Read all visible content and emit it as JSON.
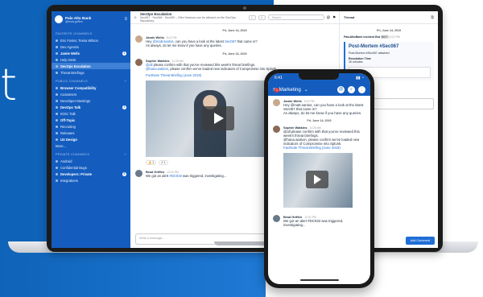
{
  "hero": {
    "letter": "t"
  },
  "sidebar": {
    "team": "Palo Alto Bank",
    "user": "@brad.griffen",
    "favorite_header": "FAVORITE CHANNELS",
    "favorites": [
      {
        "label": "Eric Foster, Tessa Wilson",
        "bold": false
      },
      {
        "label": "Dev Agenda",
        "bold": false
      },
      {
        "label": "Jamie Wells",
        "bold": true,
        "badge": "1"
      },
      {
        "label": "Help Desk",
        "bold": false
      },
      {
        "label": "SecOps Escalation",
        "bold": true,
        "active": true
      },
      {
        "label": "Threat Briefings",
        "bold": false
      }
    ],
    "public_header": "PUBLIC CHANNELS",
    "public": [
      {
        "label": "Browser Compatibility",
        "bold": true
      },
      {
        "label": "Customers",
        "bold": false
      },
      {
        "label": "Developer Meetings",
        "bold": false
      },
      {
        "label": "DevOps Talk",
        "bold": true,
        "badge": "2"
      },
      {
        "label": "IOSC Talk",
        "bold": false
      },
      {
        "label": "Off-Topic",
        "bold": true
      },
      {
        "label": "Recruiting",
        "bold": false
      },
      {
        "label": "Releases",
        "bold": false
      },
      {
        "label": "UX Design",
        "bold": true
      }
    ],
    "more": "More...",
    "private_header": "PRIVATE CHANNELS",
    "private": [
      {
        "label": "Android",
        "bold": false
      },
      {
        "label": "Confidential Bugs",
        "bold": false
      },
      {
        "label": "Developers: Private",
        "bold": true,
        "badge": "3"
      },
      {
        "label": "Integrations",
        "bold": false
      }
    ]
  },
  "channel": {
    "name": "SecOps Escalation",
    "purpose": "Sec067 · Sec068 · Sec069 – Ofed Varanoa can be allowed on the SecOps Repository.",
    "search_placeholder": "Search",
    "date1": "Fri, June 14, 2019",
    "post1": {
      "name": "Jamie Wells",
      "time": "5:12 PM",
      "text_a": "Hey ",
      "mention": "@matt.santos",
      "text_b": ", can you have a look at the latest ",
      "tag": "Sec067",
      "text_c": " that came in?",
      "line2": "As always, do let me know if you have any queries."
    },
    "date2": "Fri, June 14, 2019",
    "post2": {
      "name": "Sophie Watkins",
      "time": "11:25 AM",
      "line1": "please confirm with  that you've reviewed this week's threat briefings.",
      "mention1": "@all",
      "line2a": "@hana.watson",
      "line2b": ", please confirm we've loaded new indicators of Compromise into Splunk.",
      "link": "FactNote Threat Briefing (June 2019)",
      "reactions": [
        "👍 1",
        "✔ 1"
      ]
    },
    "post3": {
      "name": "Brad Griffen",
      "time": "12:31 PM",
      "text_a": "We got an alert ",
      "tag": "#DC033",
      "text_b": " was triggered, investigating..."
    },
    "composer_placeholder": "Write a message..."
  },
  "thread": {
    "title": "Thread",
    "date": "Fri, June 14, 2019",
    "bot": "PaloAltoBank Incident Bot",
    "bot_tag": "BOT",
    "bot_time": "4:02 PM",
    "card_title": "Post-Mortem #Sec067",
    "attached": "Post-Mortem #Sec067 attached.",
    "resolution_label": "Resolution Time",
    "resolution_value": "30 minutes",
    "file": "Sec067.pptx",
    "file_size": "PPTX 123KB",
    "complete": "Complete in record time.",
    "add_comment": "Add Comment"
  },
  "phone": {
    "time": "6:41",
    "channel": "Marketing",
    "badge": "1",
    "post1": {
      "name": "Jamie Wells",
      "time": "5:12 PM",
      "text": "Hey @matt.santos, can you have a look at the latest Sec067 that came in?",
      "line2": "As always, do let me know if you have any queries."
    },
    "date": "Fri, June 14, 2019",
    "post2": {
      "name": "Sophie Watkins",
      "time": "11:25 AM",
      "text": "@all please confirm with  that you've reviewed this week's threat briefings.",
      "text2": "@hana.watson, please confirm we've loaded new indicators of Compromise into Splunk.",
      "link": "FactNote Threat Briefing (June 2019)"
    },
    "post3": {
      "name": "Brad Griffen",
      "time": "12:31 PM",
      "text": "We got an alert #DC033 was triggered, investigating..."
    }
  }
}
